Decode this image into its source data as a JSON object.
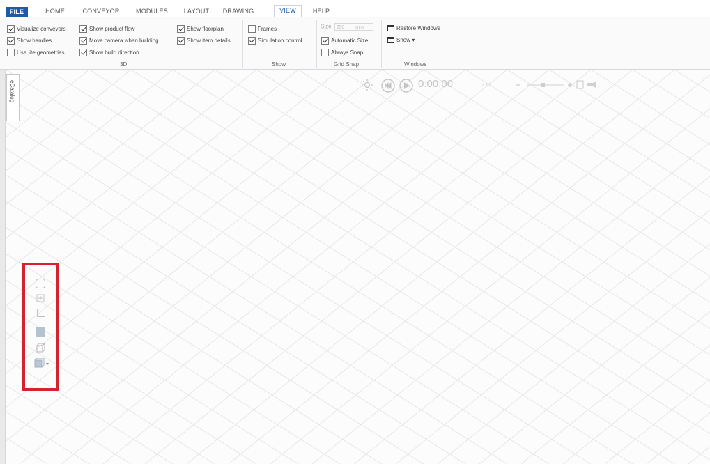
{
  "tabs": [
    "FILE",
    "HOME",
    "CONVEYOR",
    "MODULES",
    "LAYOUT",
    "DRAWING",
    "VIEW",
    "HELP"
  ],
  "ribbon": {
    "group_3d": {
      "label": "3D",
      "col1": [
        {
          "label": "Visualize conveyors",
          "checked": true
        },
        {
          "label": "Show handles",
          "checked": true
        },
        {
          "label": "Use lite geometries",
          "checked": false
        }
      ],
      "col2": [
        {
          "label": "Show product flow",
          "checked": true
        },
        {
          "label": "Move camera when building",
          "checked": true
        },
        {
          "label": "Show build direction",
          "checked": true
        }
      ],
      "col3": [
        {
          "label": "Show floorplan",
          "checked": true
        },
        {
          "label": "Show item details",
          "checked": true
        }
      ]
    },
    "group_show": {
      "label": "Show",
      "items": [
        {
          "label": "Frames",
          "checked": false
        },
        {
          "label": "Simulation control",
          "checked": true
        }
      ]
    },
    "group_grid_snap": {
      "label": "Grid Snap",
      "size_label": "Size",
      "size_value": "250",
      "size_unit": "mm",
      "items": [
        {
          "label": "Automatic Size",
          "checked": true
        },
        {
          "label": "Always Snap",
          "checked": false
        }
      ]
    },
    "group_windows": {
      "label": "Windows",
      "restore_label": "Restore Windows",
      "show_label": "Show ▾"
    }
  },
  "side_panel": {
    "ecatalog_label": "eCatalog"
  },
  "simulation": {
    "time": "0:00:00",
    "speed": "x 1.0"
  },
  "colors": {
    "file_tab": "#1f5aa6",
    "highlight": "#d6222f",
    "grid": "#e6e6e6"
  },
  "view_tools": [
    "zoom-extents-icon",
    "zoom-window-icon",
    "axis-icon",
    "plan-view-icon",
    "3d-box-icon",
    "view-cube-dropdown-icon"
  ]
}
